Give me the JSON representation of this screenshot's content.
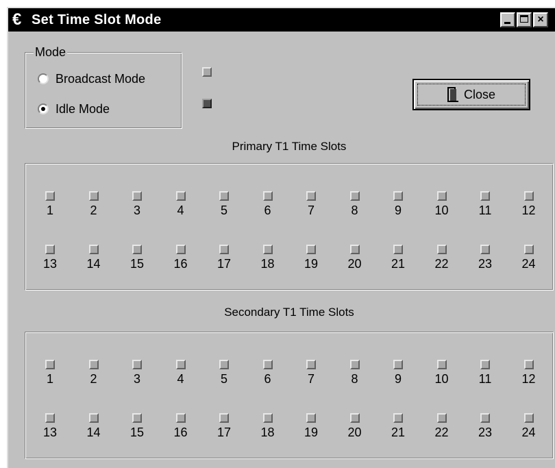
{
  "window": {
    "title": "Set Time Slot Mode",
    "buttons": {
      "minimize": "_",
      "maximize": "□",
      "close": "×"
    }
  },
  "mode": {
    "group_label": "Mode",
    "options": [
      {
        "label": "Broadcast Mode",
        "checked": false
      },
      {
        "label": "Idle Mode",
        "checked": true
      }
    ],
    "indicators": [
      {
        "state": "light"
      },
      {
        "state": "dark"
      }
    ]
  },
  "close_button": {
    "label": "Close",
    "icon": "door-icon"
  },
  "primary": {
    "title": "Primary T1 Time Slots",
    "slots": [
      "1",
      "2",
      "3",
      "4",
      "5",
      "6",
      "7",
      "8",
      "9",
      "10",
      "11",
      "12",
      "13",
      "14",
      "15",
      "16",
      "17",
      "18",
      "19",
      "20",
      "21",
      "22",
      "23",
      "24"
    ]
  },
  "secondary": {
    "title": "Secondary T1 Time Slots",
    "slots": [
      "1",
      "2",
      "3",
      "4",
      "5",
      "6",
      "7",
      "8",
      "9",
      "10",
      "11",
      "12",
      "13",
      "14",
      "15",
      "16",
      "17",
      "18",
      "19",
      "20",
      "21",
      "22",
      "23",
      "24"
    ]
  },
  "colors": {
    "face": "#c0c0c0",
    "titlebar": "#000000",
    "indicator_light": "#a8a8a8",
    "indicator_dark": "#505050"
  }
}
